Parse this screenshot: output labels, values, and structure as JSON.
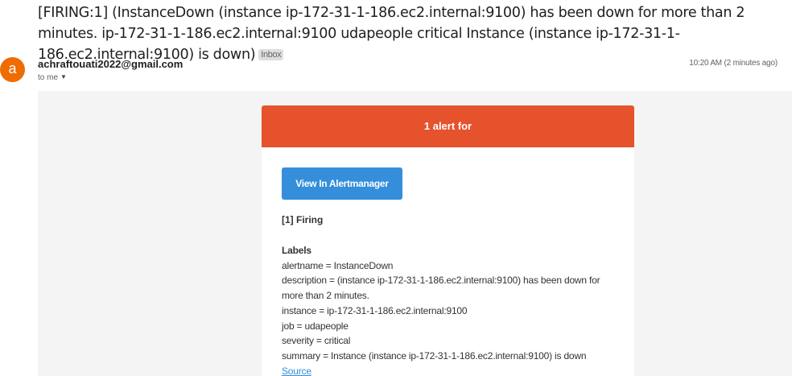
{
  "email": {
    "subject": "[FIRING:1] (InstanceDown (instance ip-172-31-1-186.ec2.internal:9100) has been down for more than 2 minutes. ip-172-31-1-186.ec2.internal:9100 udapeople critical Instance (instance ip-172-31-1-186.ec2.internal:9100) is down)",
    "folder_badge": "Inbox",
    "avatar_letter": "a",
    "sender": "achraftouati2022@gmail.com",
    "to_line": "to me",
    "timestamp": "10:20 AM (2 minutes ago)"
  },
  "alert": {
    "header": "1 alert for",
    "button_label": "View In Alertmanager",
    "firing_heading": "[1] Firing",
    "labels_title": "Labels",
    "labels": [
      "alertname = InstanceDown",
      "description = (instance ip-172-31-1-186.ec2.internal:9100) has been down for more than 2 minutes.",
      "instance = ip-172-31-1-186.ec2.internal:9100",
      "job = udapeople",
      "severity = critical",
      "summary = Instance (instance ip-172-31-1-186.ec2.internal:9100) is down"
    ],
    "source_link": "Source"
  },
  "colors": {
    "alert_header": "#e6522c",
    "button": "#348eda",
    "avatar": "#ef6c00",
    "email_background": "#f4f4f4"
  },
  "icons": {
    "recipient_dropdown": "chevron-down-icon"
  }
}
